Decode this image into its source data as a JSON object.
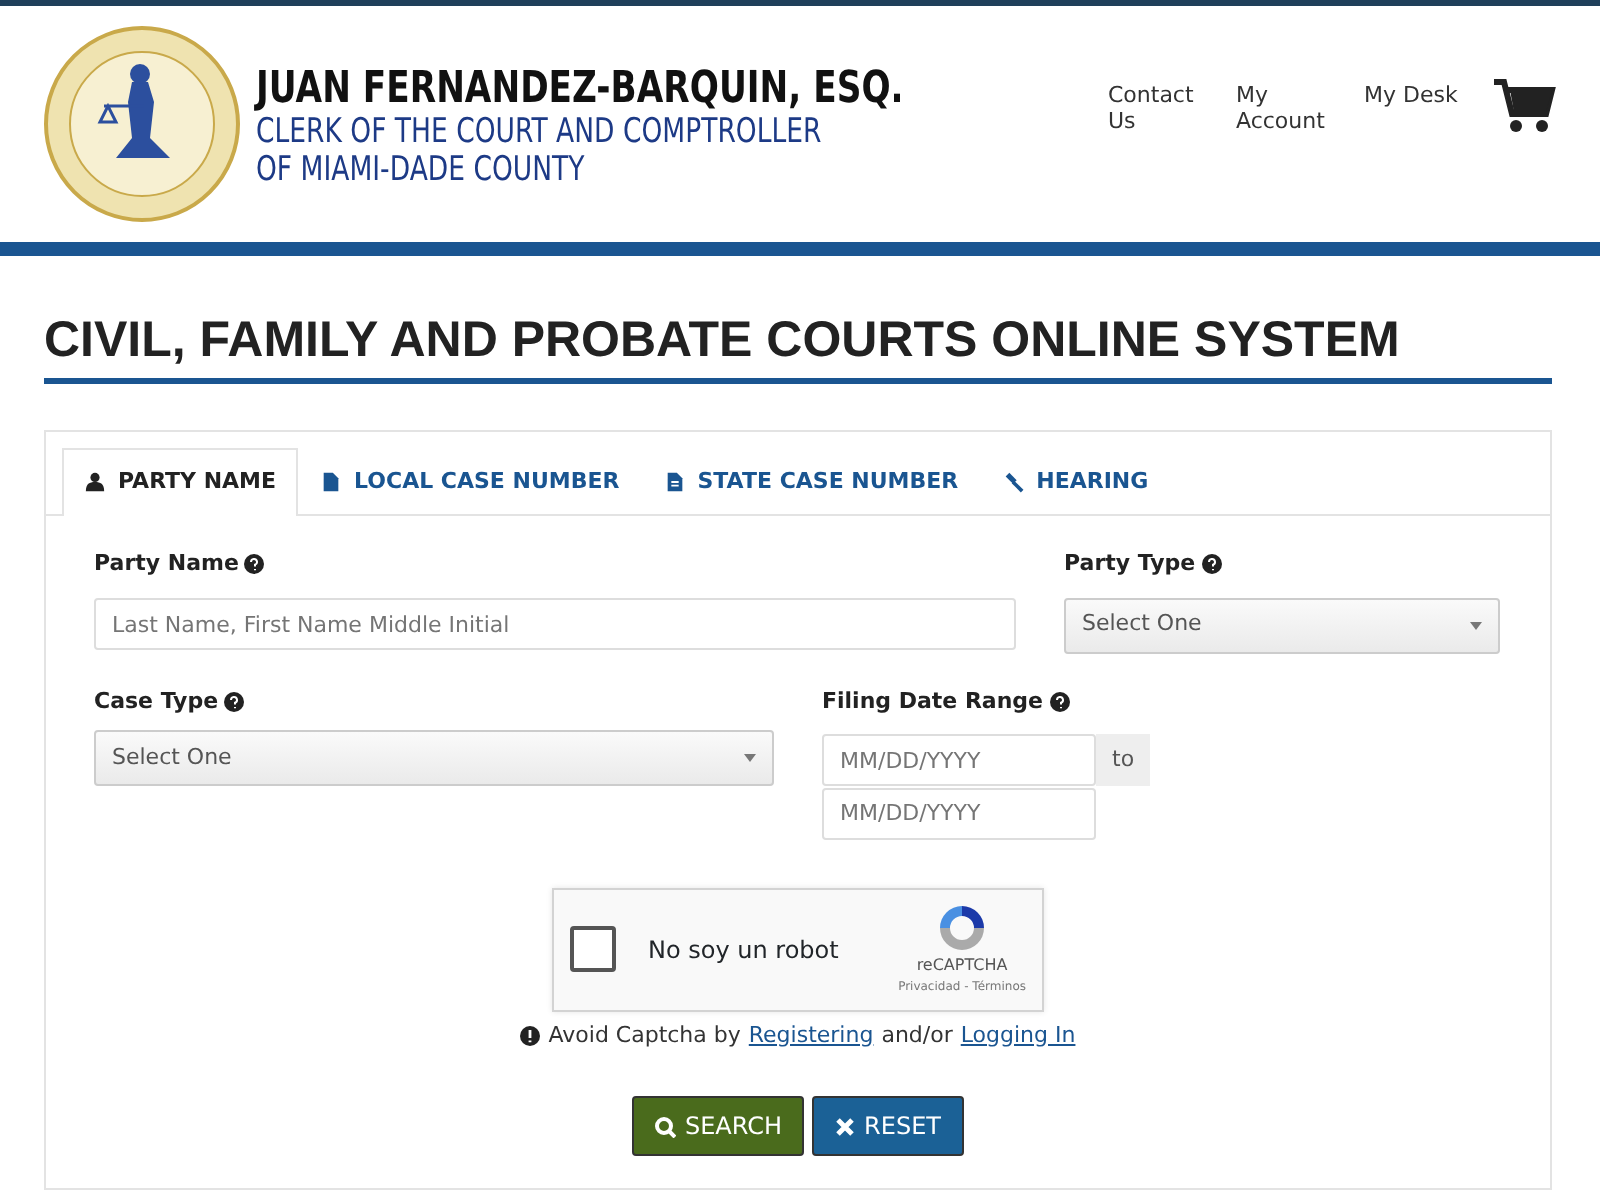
{
  "header": {
    "name": "JUAN FERNANDEZ-BARQUIN, ESQ.",
    "subtitle_lines": [
      "CLERK OF THE COURT AND COMPTROLLER",
      "OF MIAMI-DADE COUNTY"
    ],
    "nav": [
      {
        "label": "Contact Us"
      },
      {
        "label": "My Account"
      },
      {
        "label": "My Desk"
      }
    ]
  },
  "page_title": "CIVIL, FAMILY AND PROBATE COURTS ONLINE SYSTEM",
  "tabs": [
    {
      "label": "PARTY NAME",
      "selected": true
    },
    {
      "label": "LOCAL CASE NUMBER",
      "selected": false
    },
    {
      "label": "STATE CASE NUMBER",
      "selected": false
    },
    {
      "label": "HEARING",
      "selected": false
    }
  ],
  "form": {
    "party_name": {
      "label": "Party Name",
      "placeholder": "Last Name, First Name Middle Initial"
    },
    "party_type": {
      "label": "Party Type",
      "value": "Select One"
    },
    "case_type": {
      "label": "Case Type",
      "value": "Select One"
    },
    "filing_date_range": {
      "label": "Filing Date Range",
      "from_placeholder": "MM/DD/YYYY",
      "separator": "to",
      "to_placeholder": "MM/DD/YYYY"
    }
  },
  "captcha": {
    "label": "No soy un robot",
    "checked": false,
    "brand": "reCAPTCHA",
    "links": "Privacidad - Términos"
  },
  "captcha_note": {
    "text": "Avoid Captcha by",
    "link_1": "Registering",
    "middle": "and/or",
    "link_2": "Logging In"
  },
  "buttons": [
    {
      "label": "SEARCH",
      "kind": "search"
    },
    {
      "label": "RESET",
      "kind": "reset"
    }
  ]
}
